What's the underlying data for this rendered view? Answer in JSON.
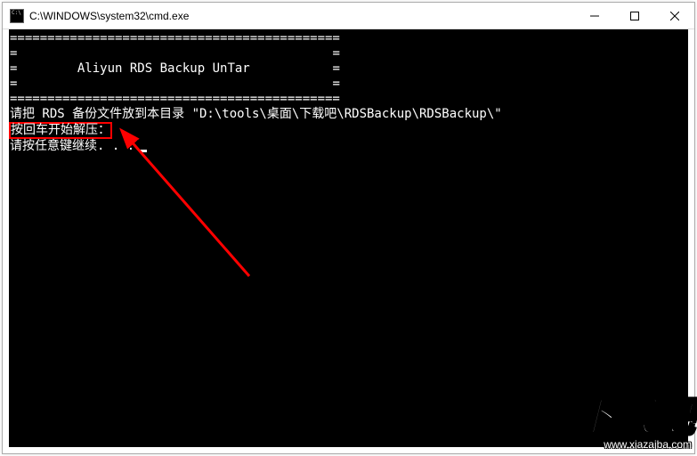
{
  "window": {
    "title": "C:\\WINDOWS\\system32\\cmd.exe"
  },
  "console": {
    "divider1": "============================================",
    "banner_side": "=",
    "banner_title": "Aliyun RDS Backup UnTar",
    "divider2": "============================================",
    "line1": "请把 RDS 备份文件放到本目录 \"D:\\tools\\桌面\\下载吧\\RDSBackup\\RDSBackup\\\"",
    "line2_highlight": "按回车开始解压：",
    "line3": "请按任意键继续. . ."
  },
  "watermark": {
    "text": "下载吧",
    "url": "www.xiazaiba.com"
  },
  "annotation": {
    "arrow_color": "#ff0000",
    "highlight_color": "#ff0000"
  }
}
